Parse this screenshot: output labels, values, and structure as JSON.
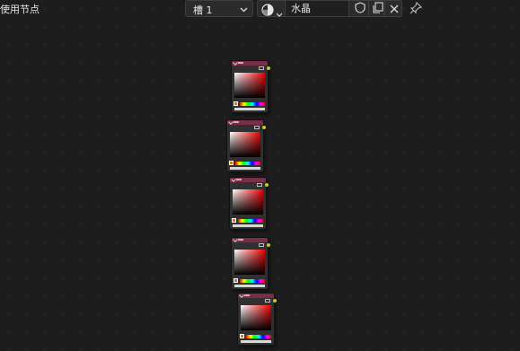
{
  "header": {
    "use_nodes_label": "使用节点",
    "slot": {
      "label": "槽 1",
      "icon": "chevron-down-icon"
    },
    "material": {
      "browse_icon": "material-sphere-icon",
      "name": "水晶",
      "fake_user_icon": "shield-icon",
      "duplicate_icon": "copy-icon",
      "unlink_icon": "close-icon"
    },
    "pin_icon": "pin-icon"
  },
  "colors": {
    "canvas_bg": "#1d1d1d",
    "node_header": "#7a2d48",
    "output_socket": "#c7c729"
  },
  "nodes": [
    {
      "type": "color-picker-node",
      "swatch_color": "#e07a10"
    },
    {
      "type": "color-picker-node",
      "swatch_color": "#e07a10"
    },
    {
      "type": "color-picker-node",
      "swatch_color": "#e07a10"
    },
    {
      "type": "color-picker-node",
      "swatch_color": "#e07a10"
    },
    {
      "type": "color-picker-node",
      "swatch_color": "#e07a10"
    }
  ]
}
